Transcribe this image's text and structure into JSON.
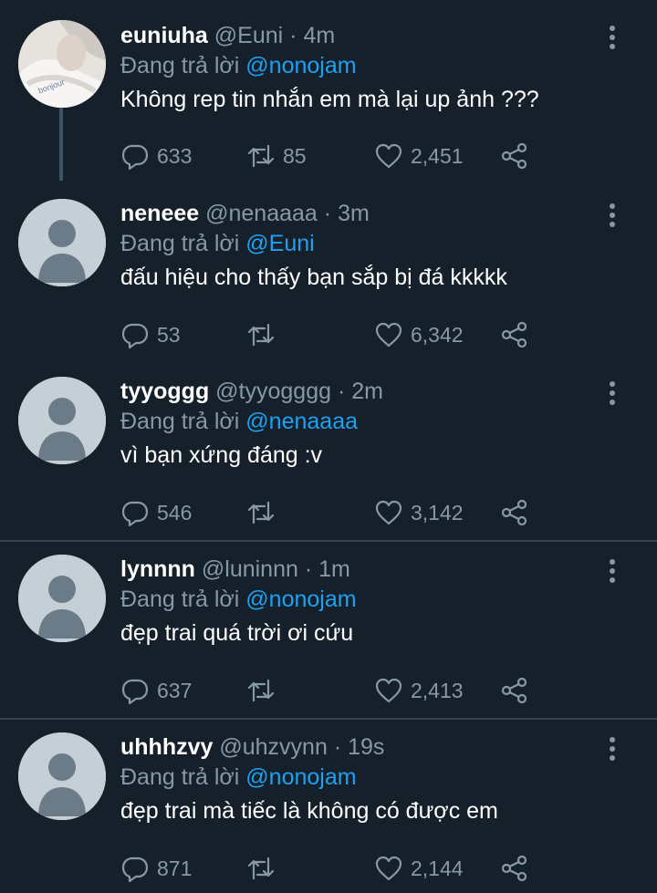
{
  "colors": {
    "background": "#15202b",
    "text": "#ffffff",
    "muted": "#8899a6",
    "mention": "#1da1f2",
    "divider": "#38444d",
    "thread_line": "#3d5466",
    "default_avatar_bg": "#c4cfd6",
    "default_avatar_fg": "#6b7c88"
  },
  "tweets": [
    {
      "name": "euniuha",
      "handle": "@Euni",
      "time": "· 4m",
      "reply_prefix": "Đang trả lời",
      "reply_to": "@nonojam",
      "text": "Không rep tin nhắn em mà lại up ảnh ???",
      "replies": "633",
      "retweets": "85",
      "likes": "2,451",
      "avatar": "photo-avatar",
      "avatar_photo_text": "bonjour"
    },
    {
      "name": "neneee",
      "handle": "@nenaaaa",
      "time": "· 3m",
      "reply_prefix": "Đang trả lời",
      "reply_to": "@Euni",
      "text": "đấu hiệu cho thấy bạn sắp bị đá kkkkk",
      "replies": "53",
      "retweets": "",
      "likes": "6,342",
      "avatar": "default-avatar"
    },
    {
      "name": "tyyoggg",
      "handle": "@tyyogggg",
      "time": "· 2m",
      "reply_prefix": "Đang trả lời",
      "reply_to": "@nenaaaa",
      "text": "vì bạn xứng đáng :v",
      "replies": "546",
      "retweets": "",
      "likes": "3,142",
      "avatar": "default-avatar"
    },
    {
      "name": "lynnnn",
      "handle": "@luninnn",
      "time": "· 1m",
      "reply_prefix": "Đang trả lời",
      "reply_to": "@nonojam",
      "text": "đẹp trai quá trời ơi cứu",
      "replies": "637",
      "retweets": "",
      "likes": "2,413",
      "avatar": "default-avatar"
    },
    {
      "name": "uhhhzvy",
      "handle": "@uhzvynn",
      "time": "· 19s",
      "reply_prefix": "Đang trả lời",
      "reply_to": "@nonojam",
      "text": "đẹp trai mà tiếc là không có được em",
      "replies": "871",
      "retweets": "",
      "likes": "2,144",
      "avatar": "default-avatar"
    }
  ]
}
